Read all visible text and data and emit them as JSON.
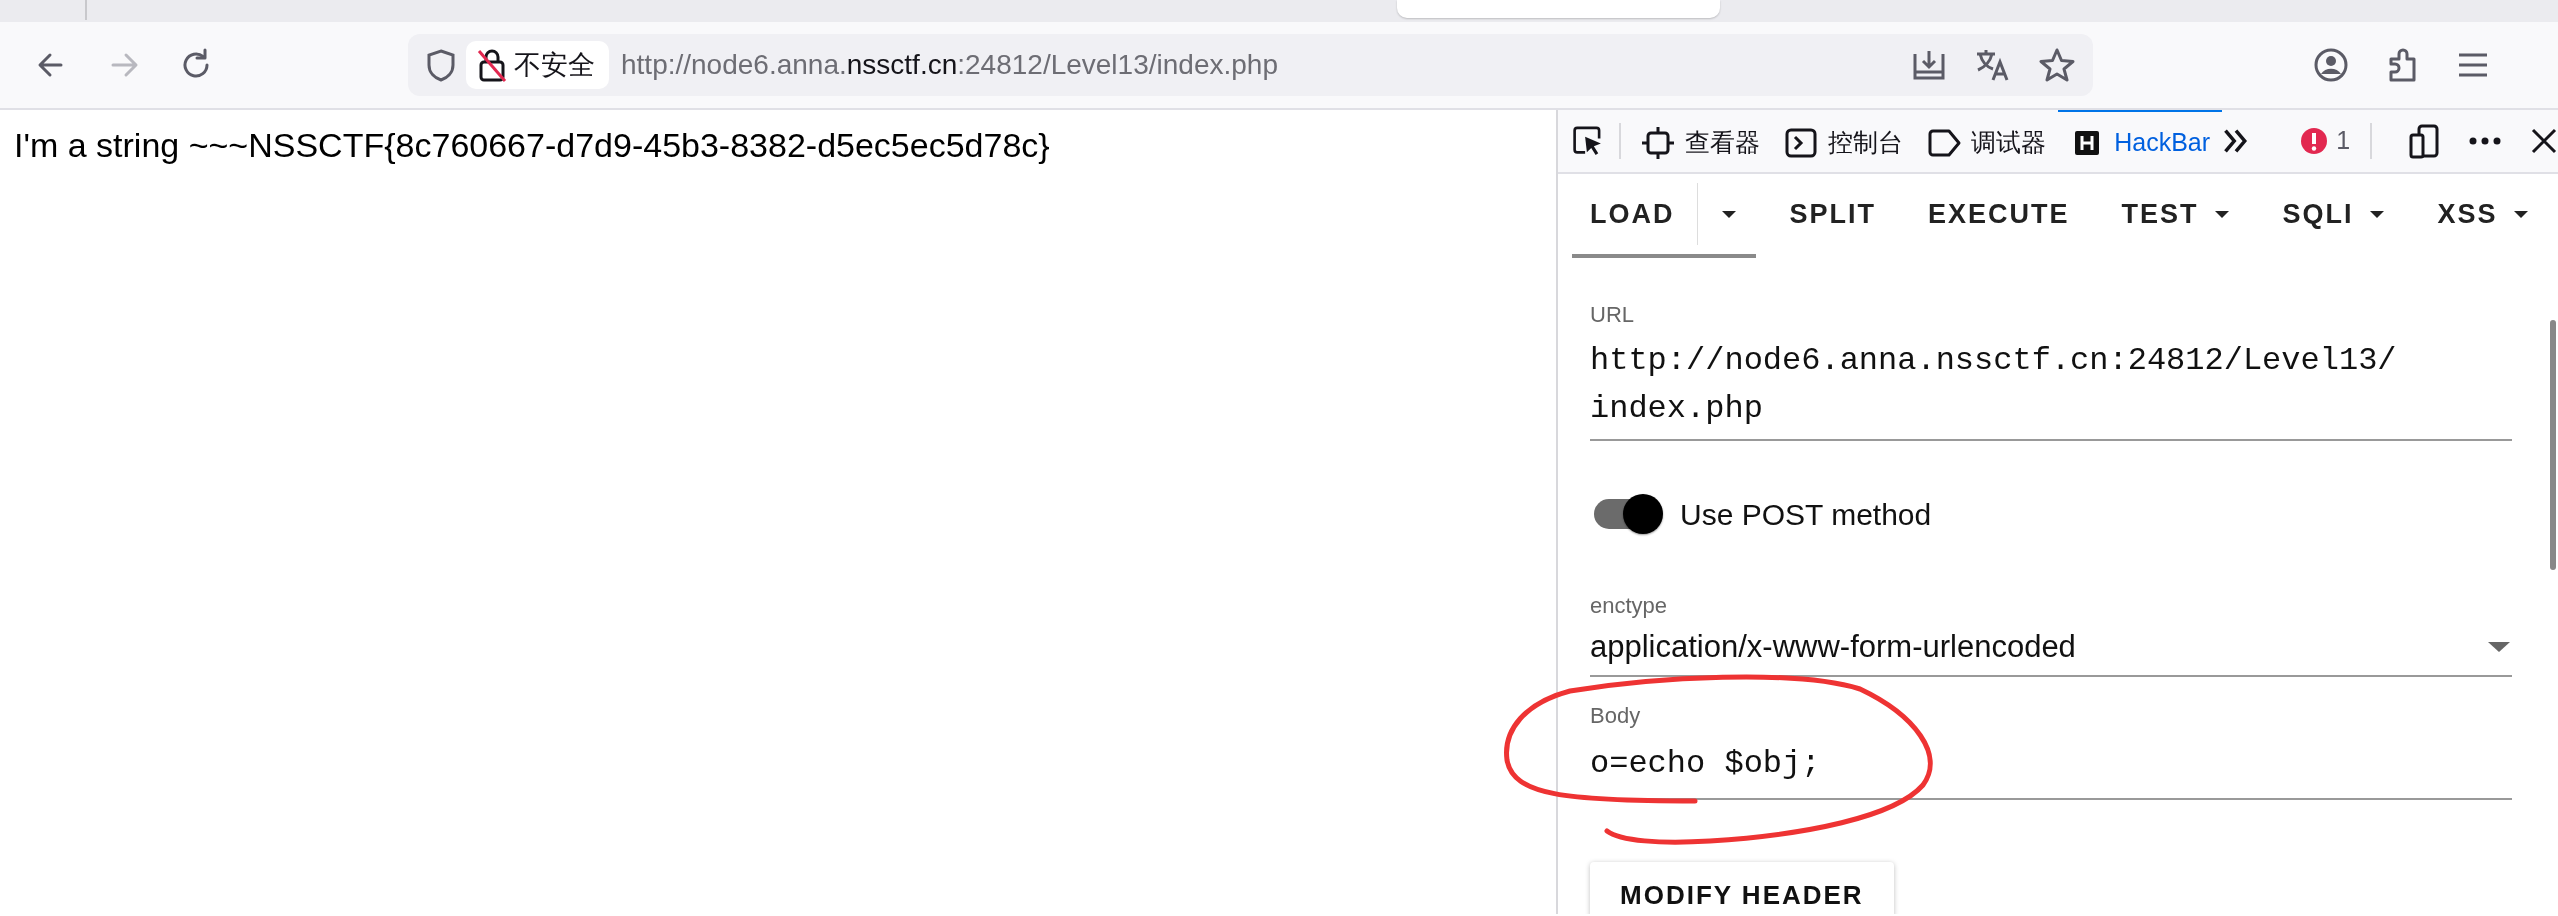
{
  "nav_buttons": [
    {
      "kind": "back",
      "disabled": false
    },
    {
      "kind": "forward",
      "disabled": true
    },
    {
      "kind": "reload",
      "disabled": false
    }
  ],
  "address_bar": {
    "security_label": "不安全",
    "url": {
      "start": "http://node6.anna.",
      "domain": "nssctf.cn",
      "rest": ":24812/Level13/index.php"
    }
  },
  "page": {
    "text": "I'm a string ~~~NSSCTF{8c760667-d7d9-45b3-8382-d5ec5ec5d78c}"
  },
  "devtools": {
    "tabs": [
      {
        "kind": "inspector",
        "label": "查看器",
        "selected": false
      },
      {
        "kind": "console",
        "label": "控制台",
        "selected": false
      },
      {
        "kind": "debugger",
        "label": "调试器",
        "selected": false
      },
      {
        "kind": "hackbar",
        "label": "HackBar",
        "selected": true
      }
    ],
    "error_count": "1"
  },
  "hackbar": {
    "menu": [
      {
        "kind": "split",
        "label": "LOAD",
        "selected": true
      },
      {
        "kind": "plain",
        "label": "SPLIT",
        "selected": false
      },
      {
        "kind": "plain",
        "label": "EXECUTE",
        "selected": false
      },
      {
        "kind": "dropdown",
        "label": "TEST",
        "selected": false
      },
      {
        "kind": "dropdown",
        "label": "SQLI",
        "selected": false
      },
      {
        "kind": "dropdown",
        "label": "XSS",
        "selected": false
      }
    ],
    "url": {
      "label": "URL",
      "value": "http://node6.anna.nssctf.cn:24812/Level13/index.php"
    },
    "post_toggle": {
      "label": "Use POST method",
      "on": true
    },
    "enctype": {
      "label": "enctype",
      "value": "application/x-www-form-urlencoded"
    },
    "body": {
      "label": "Body",
      "value": "o=echo $obj;"
    },
    "buttons": [
      "MODIFY HEADER"
    ]
  }
}
